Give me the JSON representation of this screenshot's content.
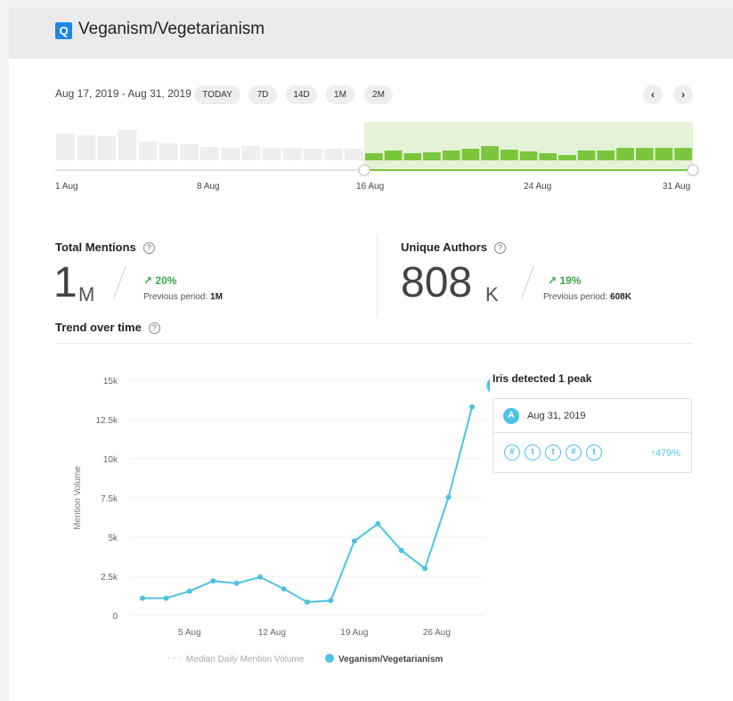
{
  "header": {
    "logo_letter": "Q",
    "title": "Veganism/Vegetarianism"
  },
  "toolbar": {
    "date_range": "Aug 17, 2019 - Aug 31, 2019",
    "presets": [
      "TODAY",
      "7D",
      "14D",
      "1M",
      "2M"
    ],
    "prev_label": "‹",
    "next_label": "›"
  },
  "timeline": {
    "labels": [
      "1 Aug",
      "8 Aug",
      "16 Aug",
      "24 Aug",
      "31 Aug"
    ],
    "selection_start": "16 Aug",
    "selection_end": "31 Aug",
    "colors": {
      "unselected": "#eeeeee",
      "selected": "#7cc63e",
      "selected_bg": "#e4f3d7"
    }
  },
  "metrics": {
    "total_mentions": {
      "label": "Total Mentions",
      "value": "1",
      "unit": "M",
      "change": "↗ 20%",
      "prev_label": "Previous period:",
      "prev_value": "1M"
    },
    "unique_authors": {
      "label": "Unique Authors",
      "value": "808",
      "unit": "K",
      "change": "↗ 19%",
      "prev_label": "Previous period:",
      "prev_value": "608K"
    },
    "help_glyph": "?"
  },
  "trend": {
    "title": "Trend over time"
  },
  "chart_data": {
    "type": "line",
    "ylabel": "Mention Volume",
    "yticks": [
      "0",
      "2.5k",
      "5k",
      "7.5k",
      "10k",
      "12.5k",
      "15k"
    ],
    "ylim": [
      0,
      15000
    ],
    "xticks": [
      {
        "label": "5 Aug",
        "day": 5
      },
      {
        "label": "12 Aug",
        "day": 12
      },
      {
        "label": "19 Aug",
        "day": 19
      },
      {
        "label": "26 Aug",
        "day": 26
      }
    ],
    "grid": true,
    "series": [
      {
        "name": "Veganism/Vegetarianism",
        "color": "#4cc3e6",
        "days": [
          1,
          3,
          5,
          7,
          9,
          11,
          13,
          15,
          17,
          19,
          21,
          23,
          25,
          27,
          29,
          31
        ],
        "values": [
          1100,
          1100,
          1550,
          2200,
          2050,
          2450,
          1700,
          850,
          950,
          4750,
          5850,
          4150,
          3000,
          7550,
          13300
        ]
      }
    ],
    "median": {
      "name": "Median Daily Mention Volume",
      "color": "#cccccc"
    },
    "peak": {
      "label": "A",
      "day": 31,
      "value": 13300
    }
  },
  "peak_panel": {
    "title": "Iris detected 1 peak",
    "badge": "A",
    "date": "Aug 31, 2019",
    "sources": [
      "#",
      "t",
      "t",
      "#",
      "t"
    ],
    "change": "↑479%"
  }
}
